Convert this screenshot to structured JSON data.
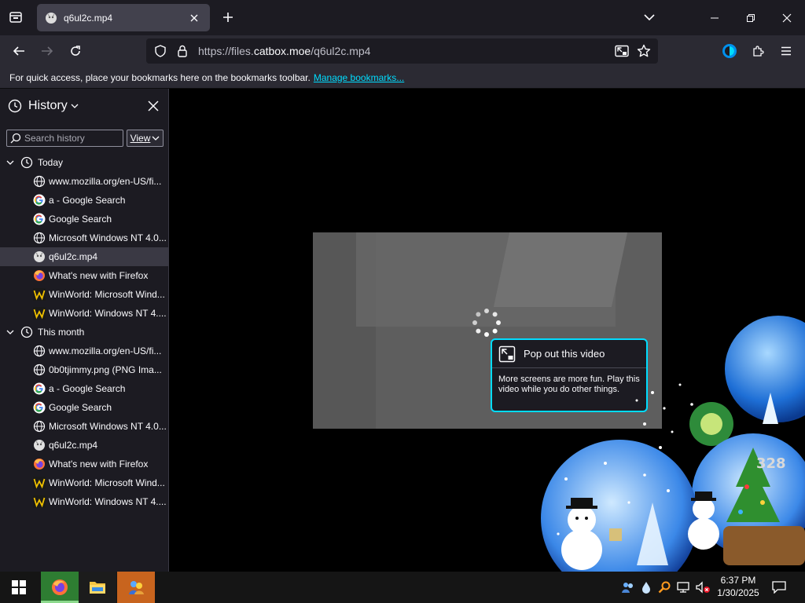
{
  "tab": {
    "title": "q6ul2c.mp4"
  },
  "urlbar": {
    "prefix": "https://files.",
    "domain": "catbox.moe",
    "path": "/q6ul2c.mp4"
  },
  "bookmarks_bar": {
    "message": "For quick access, place your bookmarks here on the bookmarks toolbar.",
    "link": "Manage bookmarks..."
  },
  "sidebar": {
    "title": "History",
    "search_placeholder": "Search history",
    "view_label": "View",
    "groups": [
      {
        "label": "Today",
        "items": [
          {
            "label": "www.mozilla.org/en-US/fi...",
            "icon": "globe-icon"
          },
          {
            "label": "a - Google Search",
            "icon": "google-icon"
          },
          {
            "label": "Google Search",
            "icon": "google-icon"
          },
          {
            "label": "Microsoft Windows NT 4.0...",
            "icon": "globe-icon"
          },
          {
            "label": "q6ul2c.mp4",
            "icon": "catbox-icon",
            "selected": true
          },
          {
            "label": "What's new with Firefox",
            "icon": "firefox-icon"
          },
          {
            "label": "WinWorld: Microsoft Wind...",
            "icon": "winworld-icon"
          },
          {
            "label": "WinWorld: Windows NT 4....",
            "icon": "winworld-icon"
          }
        ]
      },
      {
        "label": "This month",
        "items": [
          {
            "label": "www.mozilla.org/en-US/fi...",
            "icon": "globe-icon"
          },
          {
            "label": "0b0tjimmy.png (PNG Ima...",
            "icon": "globe-icon"
          },
          {
            "label": "a - Google Search",
            "icon": "google-icon"
          },
          {
            "label": "Google Search",
            "icon": "google-icon"
          },
          {
            "label": "Microsoft Windows NT 4.0...",
            "icon": "globe-icon"
          },
          {
            "label": "q6ul2c.mp4",
            "icon": "catbox-icon"
          },
          {
            "label": "What's new with Firefox",
            "icon": "firefox-icon"
          },
          {
            "label": "WinWorld: Microsoft Wind...",
            "icon": "winworld-icon"
          },
          {
            "label": "WinWorld: Windows NT 4....",
            "icon": "winworld-icon"
          }
        ]
      }
    ]
  },
  "pip_tooltip": {
    "title": "Pop out this video",
    "body": "More screens are more fun. Play this video while you do other things."
  },
  "globe_number": "328",
  "taskbar": {
    "time": "6:37 PM",
    "date": "1/30/2025"
  },
  "colors": {
    "accent": "#00ddff",
    "tab_active": "#42414d",
    "toolbar": "#2b2a33",
    "sidebar": "#1c1b22"
  }
}
